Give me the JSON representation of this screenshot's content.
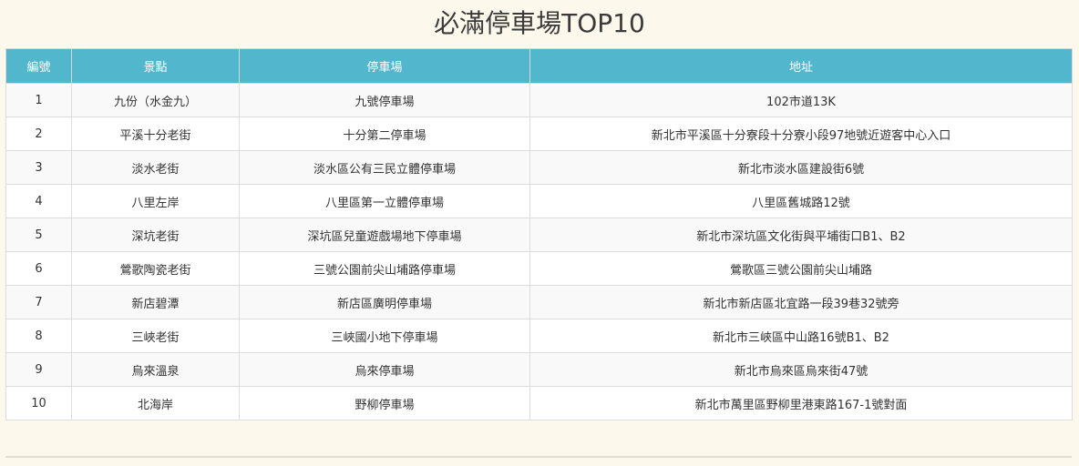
{
  "page": {
    "title": "必滿停車場TOP10"
  },
  "colors": {
    "background": "#fdf8ec",
    "header": "#52b6cc",
    "header_text": "#ffffff",
    "row_alt": "#f9f9f9"
  },
  "table": {
    "headers": [
      "編號",
      "景點",
      "停車場",
      "地址"
    ],
    "rows": [
      [
        "1",
        "九份（水金九）",
        "九號停車場",
        "102市道13K"
      ],
      [
        "2",
        "平溪十分老街",
        "十分第二停車場",
        "新北市平溪區十分寮段十分寮小段97地號近遊客中心入口"
      ],
      [
        "3",
        "淡水老街",
        "淡水區公有三民立體停車場",
        "新北市淡水區建設街6號"
      ],
      [
        "4",
        "八里左岸",
        "八里區第一立體停車場",
        "八里區舊城路12號"
      ],
      [
        "5",
        "深坑老街",
        "深坑區兒童遊戲場地下停車場",
        "新北市深坑區文化街與平埔街口B1、B2"
      ],
      [
        "6",
        "鶯歌陶瓷老街",
        "三號公園前尖山埔路停車場",
        "鶯歌區三號公園前尖山埔路"
      ],
      [
        "7",
        "新店碧潭",
        "新店區廣明停車場",
        "新北市新店區北宜路一段39巷32號旁"
      ],
      [
        "8",
        "三峽老街",
        "三峽國小地下停車場",
        "新北市三峽區中山路16號B1、B2"
      ],
      [
        "9",
        "烏來溫泉",
        "烏來停車場",
        "新北市烏來區烏來街47號"
      ],
      [
        "10",
        "北海岸",
        "野柳停車場",
        "新北市萬里區野柳里港東路167-1號對面"
      ]
    ]
  }
}
